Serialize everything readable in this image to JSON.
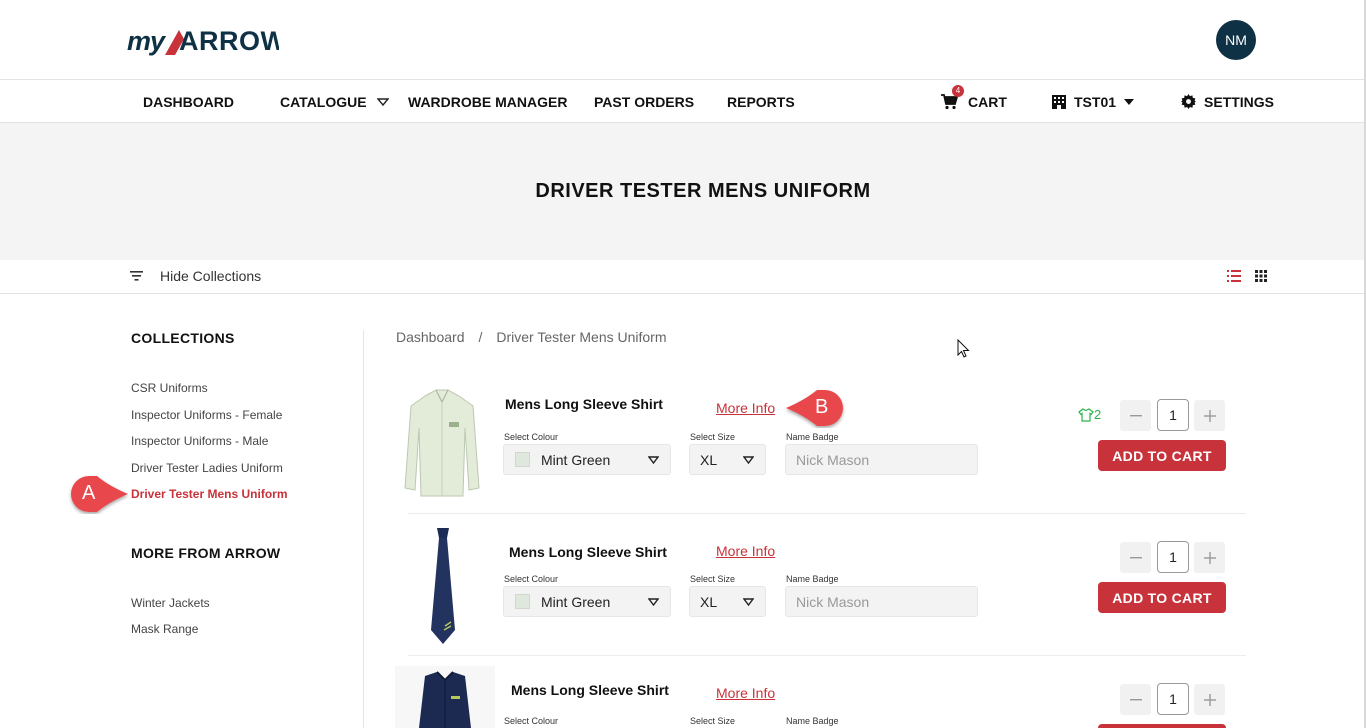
{
  "header": {
    "logo_text": "myARROW",
    "avatar_initials": "NM"
  },
  "nav": {
    "dashboard": "DASHBOARD",
    "catalogue": "CATALOGUE",
    "wardrobe": "WARDROBE MANAGER",
    "past_orders": "PAST ORDERS",
    "reports": "REPORTS",
    "cart": "CART",
    "cart_count": "4",
    "account": "TST01",
    "settings": "SETTINGS"
  },
  "hero": {
    "title": "DRIVER TESTER MENS UNIFORM"
  },
  "toolbar": {
    "hide_collections": "Hide Collections"
  },
  "sidebar": {
    "collections_heading": "COLLECTIONS",
    "collections": [
      "CSR Uniforms",
      "Inspector Uniforms - Female",
      "Inspector Uniforms - Male",
      "Driver Tester Ladies Uniform",
      "Driver Tester Mens Uniform"
    ],
    "active_collection": "Driver Tester Mens Uniform",
    "more_heading": "MORE FROM ARROW",
    "more_links": [
      "Winter Jackets",
      "Mask Range"
    ]
  },
  "breadcrumb": {
    "home": "Dashboard",
    "sep": "/",
    "current": "Driver Tester Mens Uniform"
  },
  "labels": {
    "select_colour": "Select Colour",
    "select_size": "Select Size",
    "name_badge": "Name Badge",
    "more_info": "More Info",
    "add_to_cart": "ADD TO CART"
  },
  "products": [
    {
      "name": "Mens Long Sleeve Shirt",
      "colour": "Mint Green",
      "size": "XL",
      "badge_placeholder": "Nick Mason",
      "qty": "1",
      "owned_count": "2",
      "image": "shirt"
    },
    {
      "name": "Mens Long Sleeve Shirt",
      "colour": "Mint Green",
      "size": "XL",
      "badge_placeholder": "Nick Mason",
      "qty": "1",
      "image": "tie"
    },
    {
      "name": "Mens Long Sleeve Shirt",
      "qty": "1",
      "image": "vest"
    }
  ],
  "callouts": {
    "a": "A",
    "b": "B"
  },
  "colors": {
    "accent": "#c8323a",
    "navy": "#0e3145",
    "success": "#2bb34a"
  }
}
